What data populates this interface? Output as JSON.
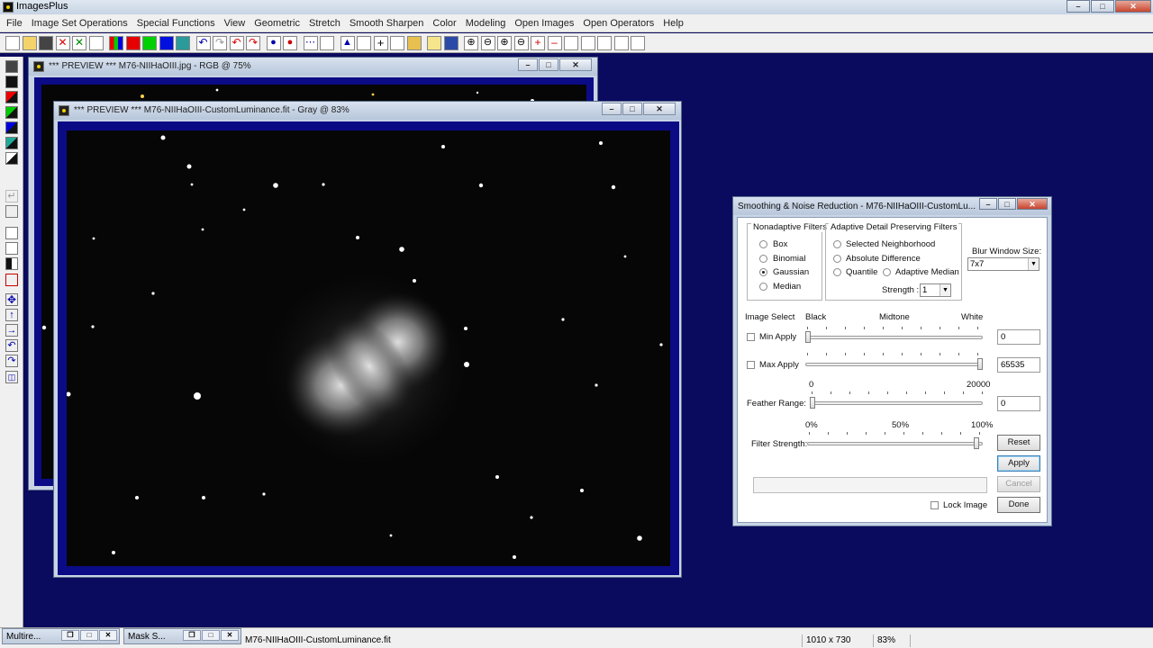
{
  "app": {
    "title": "ImagesPlus"
  },
  "menu": [
    "File",
    "Image Set Operations",
    "Special Functions",
    "View",
    "Geometric",
    "Stretch",
    "Smooth Sharpen",
    "Color",
    "Modeling",
    "Open Images",
    "Open Operators",
    "Help"
  ],
  "windows": {
    "rgb_preview": {
      "title": "*** PREVIEW *** M76-NIIHaOIII.jpg - RGB @ 75%"
    },
    "gray_preview": {
      "title": "*** PREVIEW *** M76-NIIHaOIII-CustomLuminance.fit - Gray @ 83%"
    }
  },
  "dialog": {
    "title": "Smoothing & Noise Reduction - M76-NIIHaOIII-CustomLu...",
    "nonadaptive": {
      "legend": "Nonadaptive Filters",
      "options": [
        "Box",
        "Binomial",
        "Gaussian",
        "Median"
      ],
      "selected": "Gaussian"
    },
    "adaptive": {
      "legend": "Adaptive Detail Preserving Filters",
      "options": [
        "Selected Neighborhood",
        "Absolute Difference",
        "Quantile",
        "Adaptive Median"
      ],
      "strength_label": "Strength :",
      "strength_value": "1"
    },
    "blur": {
      "label": "Blur Window Size:",
      "value": "7x7"
    },
    "image_select": {
      "label": "Image Select",
      "black": "Black",
      "midtone": "Midtone",
      "white": "White",
      "min_apply": "Min Apply",
      "min_value": "0",
      "max_apply": "Max Apply",
      "max_value": "65535"
    },
    "feather": {
      "label": "Feather Range:",
      "min_label": "0",
      "max_label": "20000",
      "value": "0"
    },
    "filter_strength": {
      "label": "Filter Strength:",
      "l0": "0%",
      "l50": "50%",
      "l100": "100%",
      "value_fraction": 0.98
    },
    "buttons": {
      "reset": "Reset",
      "apply": "Apply",
      "cancel": "Cancel",
      "done": "Done"
    },
    "lock_image": "Lock Image"
  },
  "taskbar": {
    "minimized": [
      "Multire...",
      "Mask S..."
    ],
    "status_file": "M76-NIIHaOIII-CustomLuminance.fit",
    "status_dims": "1010 x 730",
    "status_zoom": "83%"
  }
}
